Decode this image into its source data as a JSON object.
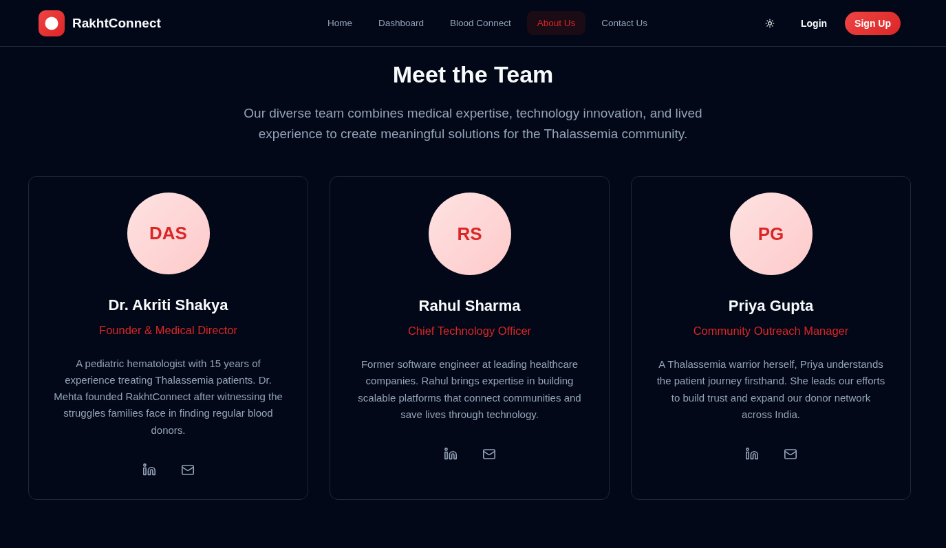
{
  "header": {
    "brand": "RakhtConnect",
    "nav": [
      {
        "label": "Home",
        "selected": false
      },
      {
        "label": "Dashboard",
        "selected": false
      },
      {
        "label": "Blood Connect",
        "selected": false
      },
      {
        "label": "About Us",
        "selected": true
      },
      {
        "label": "Contact Us",
        "selected": false
      }
    ],
    "login": "Login",
    "signup": "Sign Up"
  },
  "team_section": {
    "title": "Meet the Team",
    "subtitle": "Our diverse team combines medical expertise, technology innovation, and lived experience to create meaningful solutions for the Thalassemia community.",
    "members": [
      {
        "initials": "DAS",
        "name": "Dr. Akriti Shakya",
        "role": "Founder & Medical Director",
        "bio": "A pediatric hematologist with 15 years of experience treating Thalassemia patients. Dr. Mehta founded RakhtConnect after witnessing the struggles families face in finding regular blood donors."
      },
      {
        "initials": "RS",
        "name": "Rahul Sharma",
        "role": "Chief Technology Officer",
        "bio": "Former software engineer at leading healthcare companies. Rahul brings expertise in building scalable platforms that connect communities and save lives through technology."
      },
      {
        "initials": "PG",
        "name": "Priya Gupta",
        "role": "Community Outreach Manager",
        "bio": "A Thalassemia warrior herself, Priya understands the patient journey firsthand. She leads our efforts to build trust and expand our donor network across India."
      }
    ]
  }
}
